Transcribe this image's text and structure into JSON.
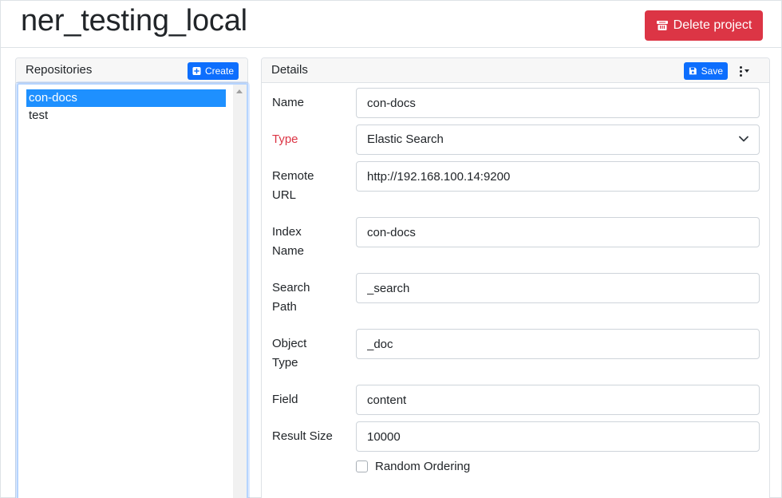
{
  "header": {
    "title": "ner_testing_local",
    "delete_label": "Delete project"
  },
  "repositories": {
    "title": "Repositories",
    "create_label": "Create",
    "items": [
      {
        "label": "con-docs",
        "selected": true
      },
      {
        "label": "test",
        "selected": false
      }
    ]
  },
  "details": {
    "title": "Details",
    "save_label": "Save",
    "fields": {
      "name": {
        "label": "Name",
        "value": "con-docs"
      },
      "type": {
        "label": "Type",
        "value": "Elastic Search"
      },
      "remote_url": {
        "label_line1": "Remote",
        "label_line2": "URL",
        "value": "http://192.168.100.14:9200"
      },
      "index_name": {
        "label_line1": "Index",
        "label_line2": "Name",
        "value": "con-docs"
      },
      "search_path": {
        "label_line1": "Search",
        "label_line2": "Path",
        "value": "_search"
      },
      "object_type": {
        "label_line1": "Object",
        "label_line2": "Type",
        "value": "_doc"
      },
      "field": {
        "label": "Field",
        "value": "content"
      },
      "result_size": {
        "label": "Result Size",
        "value": "10000"
      }
    },
    "random_ordering_label": "Random Ordering",
    "random_ordering_checked": false
  },
  "colors": {
    "danger": "#dc3545",
    "primary": "#0d6efd",
    "selection": "#1e90ff"
  }
}
